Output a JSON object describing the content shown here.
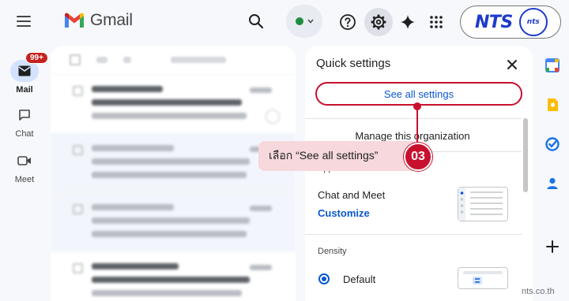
{
  "rail": {
    "items": [
      {
        "label": "Mail",
        "badge": "99+"
      },
      {
        "label": "Chat"
      },
      {
        "label": "Meet"
      }
    ]
  },
  "header": {
    "app_name": "Gmail",
    "status": "active",
    "brand": {
      "logo_text": "NTS",
      "logo_small": "nts"
    }
  },
  "quick_settings": {
    "title": "Quick settings",
    "see_all_label": "See all settings",
    "manage_org": "Manage this organization",
    "apps_heading": "Apps in Gmail",
    "chat_meet_label": "Chat and Meet",
    "customize_label": "Customize",
    "density_heading": "Density",
    "density_option": "Default"
  },
  "annotation": {
    "text": "เลือก “See all settings”",
    "step": "03",
    "color": "#c8102e"
  },
  "watermark": "nts.co.th",
  "colors": {
    "accent": "#0b57d0",
    "highlight": "#c8102e",
    "brand": "#1d3bc9"
  }
}
